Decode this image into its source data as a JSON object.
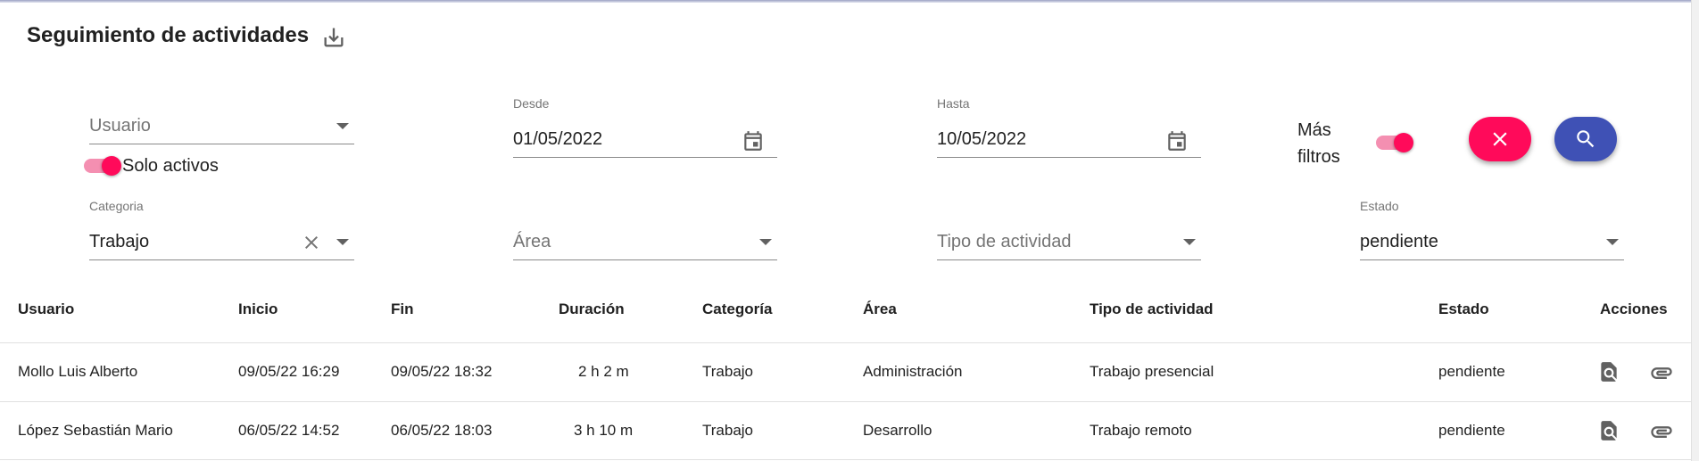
{
  "header": {
    "title": "Seguimiento de actividades",
    "download_icon": "download-icon"
  },
  "filters": {
    "usuario": {
      "placeholder": "Usuario"
    },
    "solo_activos": {
      "label": "Solo activos",
      "on": true
    },
    "desde": {
      "label": "Desde",
      "value": "01/05/2022"
    },
    "hasta": {
      "label": "Hasta",
      "value": "10/05/2022"
    },
    "mas_filtros": {
      "label_line1": "Más",
      "label_line2": "filtros",
      "on": true
    },
    "categoria": {
      "label": "Categoria",
      "value": "Trabajo"
    },
    "area": {
      "placeholder": "Área"
    },
    "tipo_actividad": {
      "placeholder": "Tipo de actividad"
    },
    "estado": {
      "label": "Estado",
      "value": "pendiente"
    }
  },
  "buttons": {
    "clear_icon": "close-icon",
    "search_icon": "search-icon"
  },
  "colors": {
    "accent": "#ff0a5a",
    "primary": "#3f51b5"
  },
  "table": {
    "columns": [
      "Usuario",
      "Inicio",
      "Fin",
      "Duración",
      "Categoría",
      "Área",
      "Tipo de actividad",
      "Estado",
      "Acciones"
    ],
    "rows": [
      [
        "Mollo Luis Alberto",
        "09/05/22 16:29",
        "09/05/22 18:32",
        "2 h 2 m",
        "Trabajo",
        "Administración",
        "Trabajo presencial",
        "pendiente"
      ],
      [
        "López Sebastián Mario",
        "06/05/22 14:52",
        "06/05/22 18:03",
        "3 h 10 m",
        "Trabajo",
        "Desarrollo",
        "Trabajo remoto",
        "pendiente"
      ]
    ]
  }
}
